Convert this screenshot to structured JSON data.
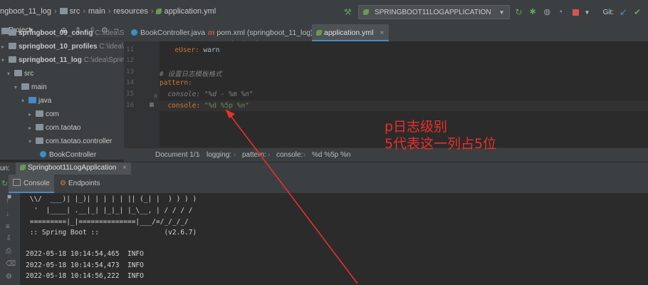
{
  "breadcrumb": [
    "ngboot_11_log",
    "src",
    "main",
    "resources",
    "application.yml"
  ],
  "run_config": "SPRINGBOOT11LOGAPPLICATION",
  "git_label": "Git:",
  "project": {
    "title": "Project",
    "rows": [
      {
        "name": "springboot_09_config",
        "path": "C:\\idea\\SpringBo"
      },
      {
        "name": "springboot_10_profiles",
        "path": "C:\\idea\\SpringB"
      },
      {
        "name": "springboot_11_log",
        "path": "C:\\idea\\SpringBoot\\"
      },
      {
        "name": "src",
        "path": ""
      },
      {
        "name": "main",
        "path": ""
      },
      {
        "name": "java",
        "path": ""
      },
      {
        "name": "com",
        "path": ""
      },
      {
        "name": "com.taotao",
        "path": ""
      },
      {
        "name": "com.taotao.controller",
        "path": ""
      },
      {
        "name": "BookController",
        "path": ""
      }
    ]
  },
  "tabs": [
    {
      "label": "BookController.java"
    },
    {
      "label": "pom.xml (springboot_11_log)"
    },
    {
      "label": "application.yml"
    }
  ],
  "editor": {
    "line_numbers": [
      "11",
      "12",
      "13",
      "14",
      "15",
      "16"
    ],
    "lines": {
      "l11_key": "eUser",
      "l11_val": "warn",
      "l13_comment": "# 设置日志模板格式",
      "l14_key": "pattern",
      "l15_key": "console",
      "l15_val": "\"%d - %m %n\"",
      "l16_key": "console",
      "l16_val": "\"%d %5p %n\""
    }
  },
  "statusbar": [
    "Document 1/1",
    "logging:",
    "pattern:",
    "console:",
    "%d %5p %n"
  ],
  "annotation": {
    "line1": "p日志级别",
    "line2": "5代表这一列占5位",
    "color": "#e8302c"
  },
  "run": {
    "label": "un:",
    "app_tab": "Springboot11LogApplication",
    "console_tab": "Console",
    "endpoints_tab": "Endpoints"
  },
  "console_lines": [
    " \\\\/  ___)| |_)| | | | | || (_| |  ) ) ) )",
    "  '  |____| .__|_| |_|_| |_\\__, | / / / /",
    " =========|_|==============|___/=/_/_/_/",
    " :: Spring Boot ::                (v2.6.7)",
    "",
    "2022-05-18 10:14:54,465  INFO",
    "2022-05-18 10:14:54,473  INFO",
    "2022-05-18 10:14:56,222  INFO"
  ]
}
